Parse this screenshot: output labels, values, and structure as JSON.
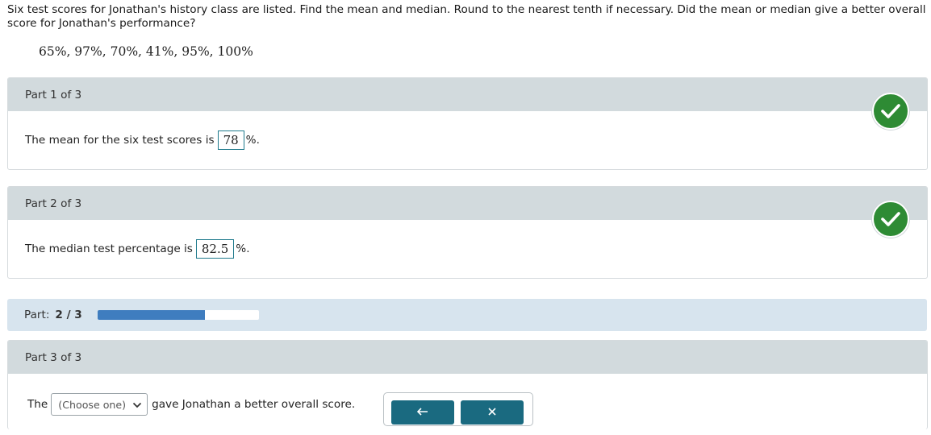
{
  "question": {
    "text": "Six test scores for Jonathan's history class are listed. Find the mean and median. Round to the nearest tenth if necessary. Did the mean or median give a better overall score for Jonathan's performance?",
    "scores": "65%, 97%, 70%, 41%, 95%, 100%"
  },
  "parts": {
    "p1": {
      "title": "Part 1 of 3",
      "prefix": "The mean for the six test scores is",
      "answer": "78",
      "suffix": "%.",
      "status": "correct"
    },
    "p2": {
      "title": "Part 2 of 3",
      "prefix": "The median test percentage is",
      "answer": "82.5",
      "suffix": "%.",
      "status": "correct"
    },
    "p3": {
      "title": "Part 3 of 3",
      "prefix": "The",
      "select_value": "(Choose one)",
      "suffix": "gave Jonathan a better overall score."
    }
  },
  "progress": {
    "label": "Part:",
    "value_text": "2 / 3",
    "fraction": 0.6667
  },
  "colors": {
    "check": "#2e8b34",
    "header": "#d2dadd",
    "progress_fill": "#3f7dbf",
    "button": "#1a6a80"
  },
  "icons": {
    "status": "checkmark-icon",
    "undo": "undo-icon",
    "clear": "clear-x-icon",
    "dropdown": "chevron-down-icon"
  }
}
